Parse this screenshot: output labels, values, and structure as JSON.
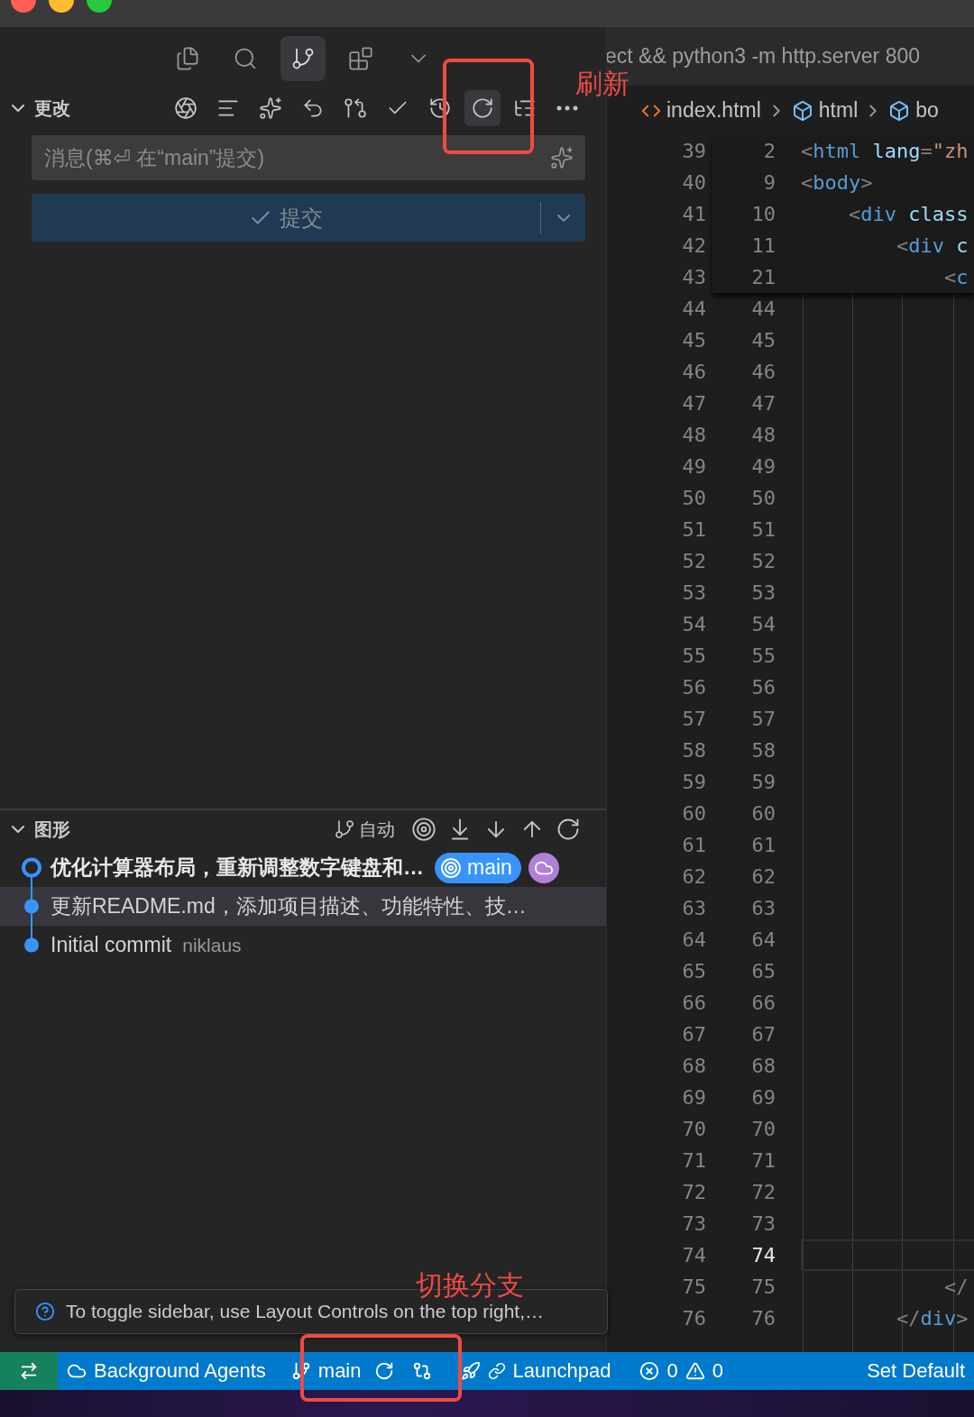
{
  "sidebar": {
    "activity_tabs": [
      {
        "kind": "files",
        "selected": false
      },
      {
        "kind": "search",
        "selected": false
      },
      {
        "kind": "source-control",
        "selected": true
      },
      {
        "kind": "extensions",
        "selected": false
      },
      {
        "kind": "more",
        "selected": false
      }
    ],
    "changes": {
      "title": "更改",
      "expanded": true,
      "toolbar": [
        {
          "kind": "ai"
        },
        {
          "kind": "lines"
        },
        {
          "kind": "sparkle"
        },
        {
          "kind": "undo-add"
        },
        {
          "kind": "graph"
        },
        {
          "kind": "check"
        },
        {
          "kind": "history"
        },
        {
          "kind": "refresh",
          "hovered": true
        },
        {
          "kind": "tree"
        },
        {
          "kind": "more"
        }
      ],
      "message": {
        "placeholder": "消息(⌘⏎ 在“main”提交)"
      },
      "commit_button": {
        "label": "提交",
        "disabled": true
      }
    },
    "graph": {
      "title": "图形",
      "expanded": true,
      "mode": "自动",
      "commits": [
        {
          "message": "优化计算器布局，重新调整数字键盘和…",
          "bold": true,
          "head": true,
          "selected": false,
          "refs": [
            {
              "kind": "branch",
              "label": "main",
              "color": "#3794ff"
            },
            {
              "kind": "remote",
              "color": "#b180d7"
            }
          ]
        },
        {
          "message": "更新README.md，添加项目描述、功能特性、技…",
          "bold": false,
          "head": false,
          "selected": true
        },
        {
          "message": "Initial commit",
          "author": "niklaus",
          "bold": false,
          "head": false,
          "selected": false
        }
      ]
    }
  },
  "editor": {
    "title": "ect && python3 -m http.server 800",
    "breadcrumbs": [
      {
        "kind": "file",
        "label": "index.html"
      },
      {
        "kind": "element",
        "label": "html"
      },
      {
        "kind": "element",
        "label": "bo"
      }
    ],
    "sticky": [
      {
        "number": "2",
        "tokens": [
          {
            "text": "<",
            "kind": "punct"
          },
          {
            "text": "html",
            "kind": "tag"
          },
          {
            "text": " lang",
            "kind": "attr"
          },
          {
            "text": "=",
            "kind": "punct"
          },
          {
            "text": "\"zh",
            "kind": "string"
          }
        ]
      },
      {
        "number": "9",
        "tokens": [
          {
            "text": "<",
            "kind": "punct"
          },
          {
            "text": "body",
            "kind": "tag"
          },
          {
            "text": ">",
            "kind": "punct"
          }
        ]
      },
      {
        "number": "10",
        "tokens": [
          {
            "text": "    <",
            "kind": "punct"
          },
          {
            "text": "div",
            "kind": "tag"
          },
          {
            "text": " class",
            "kind": "attr"
          }
        ]
      },
      {
        "number": "11",
        "tokens": [
          {
            "text": "        <",
            "kind": "punct"
          },
          {
            "text": "div",
            "kind": "tag"
          },
          {
            "text": " c",
            "kind": "attr"
          }
        ]
      },
      {
        "number": "21",
        "tokens": [
          {
            "text": "            <",
            "kind": "punct"
          },
          {
            "text": "c",
            "kind": "tag"
          }
        ]
      }
    ],
    "rows": [
      {
        "old": "39"
      },
      {
        "old": "40"
      },
      {
        "old": "41"
      },
      {
        "old": "42"
      },
      {
        "old": "43"
      },
      {
        "old": "44",
        "new": "44"
      },
      {
        "old": "45",
        "new": "45"
      },
      {
        "old": "46",
        "new": "46"
      },
      {
        "old": "47",
        "new": "47"
      },
      {
        "old": "48",
        "new": "48"
      },
      {
        "old": "49",
        "new": "49"
      },
      {
        "old": "50",
        "new": "50"
      },
      {
        "old": "51",
        "new": "51"
      },
      {
        "old": "52",
        "new": "52"
      },
      {
        "old": "53",
        "new": "53"
      },
      {
        "old": "54",
        "new": "54"
      },
      {
        "old": "55",
        "new": "55"
      },
      {
        "old": "56",
        "new": "56"
      },
      {
        "old": "57",
        "new": "57"
      },
      {
        "old": "58",
        "new": "58"
      },
      {
        "old": "59",
        "new": "59"
      },
      {
        "old": "60",
        "new": "60"
      },
      {
        "old": "61",
        "new": "61"
      },
      {
        "old": "62",
        "new": "62"
      },
      {
        "old": "63",
        "new": "63"
      },
      {
        "old": "64",
        "new": "64"
      },
      {
        "old": "65",
        "new": "65"
      },
      {
        "old": "66",
        "new": "66"
      },
      {
        "old": "67",
        "new": "67"
      },
      {
        "old": "68",
        "new": "68"
      },
      {
        "old": "69",
        "new": "69"
      },
      {
        "old": "70",
        "new": "70"
      },
      {
        "old": "71",
        "new": "71"
      },
      {
        "old": "72",
        "new": "72"
      },
      {
        "old": "73",
        "new": "73"
      },
      {
        "old": "74",
        "new": "74",
        "current": true
      },
      {
        "old": "75",
        "new": "75",
        "tokens": [
          {
            "text": "            </",
            "kind": "punct"
          }
        ]
      },
      {
        "old": "76",
        "new": "76",
        "tokens": [
          {
            "text": "        </",
            "kind": "punct"
          },
          {
            "text": "div",
            "kind": "tag"
          },
          {
            "text": ">",
            "kind": "punct"
          }
        ]
      }
    ]
  },
  "tooltip": {
    "text": "To toggle sidebar, use Layout Controls on the top right,…"
  },
  "status_bar": {
    "items": [
      {
        "kind": "remote"
      },
      {
        "kind": "agents",
        "label": "Background Agents"
      },
      {
        "kind": "branch",
        "label": "main"
      },
      {
        "kind": "compare"
      },
      {
        "kind": "launchpad",
        "label": "Launchpad"
      },
      {
        "kind": "problems",
        "errors": "0",
        "warnings": "0"
      },
      {
        "kind": "text",
        "label": "Set Default"
      }
    ]
  },
  "annotations": [
    {
      "text": "刷新"
    },
    {
      "text": "切换分支"
    }
  ]
}
